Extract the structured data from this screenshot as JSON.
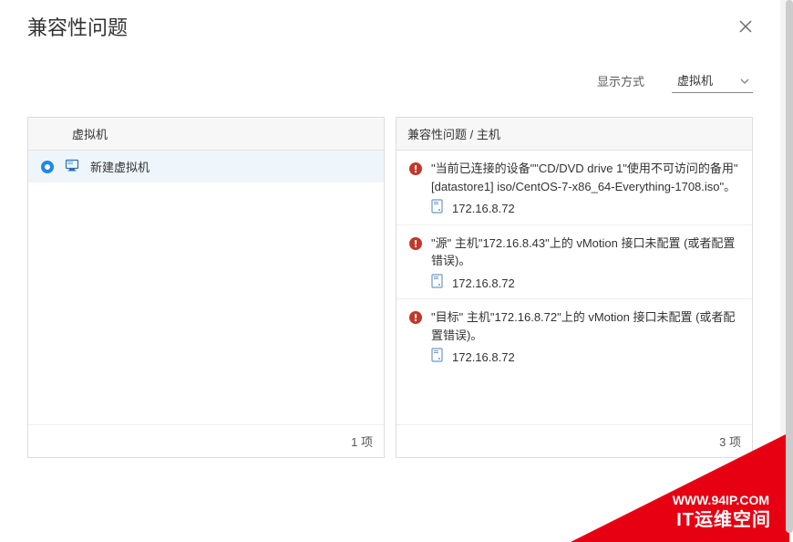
{
  "dialog": {
    "title": "兼容性问题",
    "display_mode_label": "显示方式",
    "display_mode_value": "虚拟机"
  },
  "left_panel": {
    "header": "虚拟机",
    "vm": {
      "name": "新建虚拟机",
      "selected": true
    },
    "footer": "1 项"
  },
  "right_panel": {
    "header": "兼容性问题 / 主机",
    "issues": [
      {
        "message": "\"当前已连接的设备\"\"CD/DVD drive 1\"使用不可访问的备用\"[datastore1] iso/CentOS-7-x86_64-Everything-1708.iso\"。",
        "host": "172.16.8.72"
      },
      {
        "message": "\"源\" 主机\"172.16.8.43\"上的 vMotion 接口未配置 (或者配置错误)。",
        "host": "172.16.8.72"
      },
      {
        "message": "\"目标\" 主机\"172.16.8.72\"上的 vMotion 接口未配置 (或者配置错误)。",
        "host": "172.16.8.72"
      }
    ],
    "footer": "3 项"
  },
  "watermark": {
    "line1": "WWW.94IP.COM",
    "line2": "IT运维空间"
  }
}
